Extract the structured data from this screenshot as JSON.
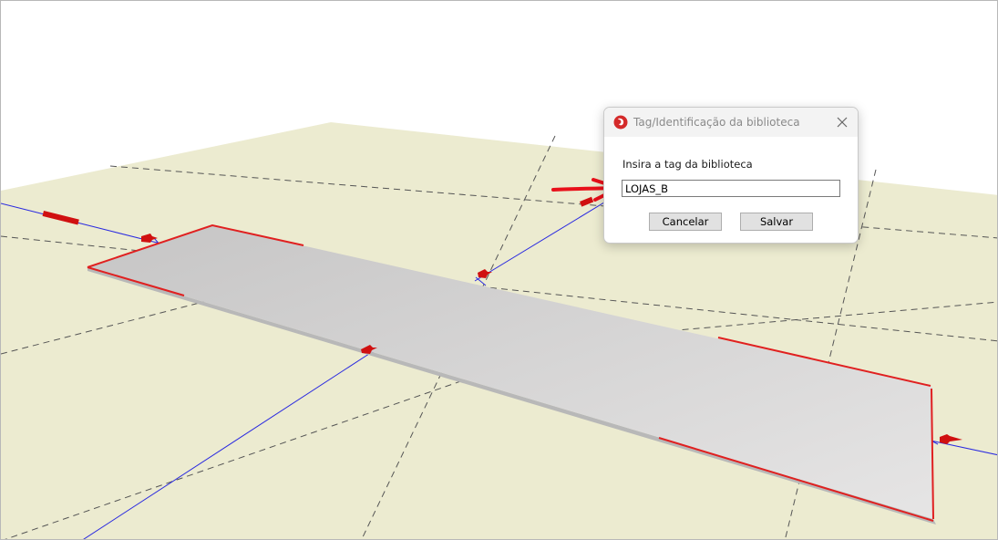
{
  "dialog": {
    "title": "Tag/Identificação da biblioteca",
    "prompt": "Insira a tag da biblioteca",
    "input_value": "LOJAS_B",
    "cancel_label": "Cancelar",
    "save_label": "Salvar",
    "app_icon": "app-logo-icon",
    "close_icon": "close-icon"
  },
  "colors": {
    "ground": "#ecebd0",
    "grid": "#555555",
    "axis": "#2a2ae0",
    "edge": "#e02020",
    "slab_light": "#e4e3e3",
    "slab_dark": "#c4c3c3",
    "annotation_arrow": "#e8101a"
  }
}
